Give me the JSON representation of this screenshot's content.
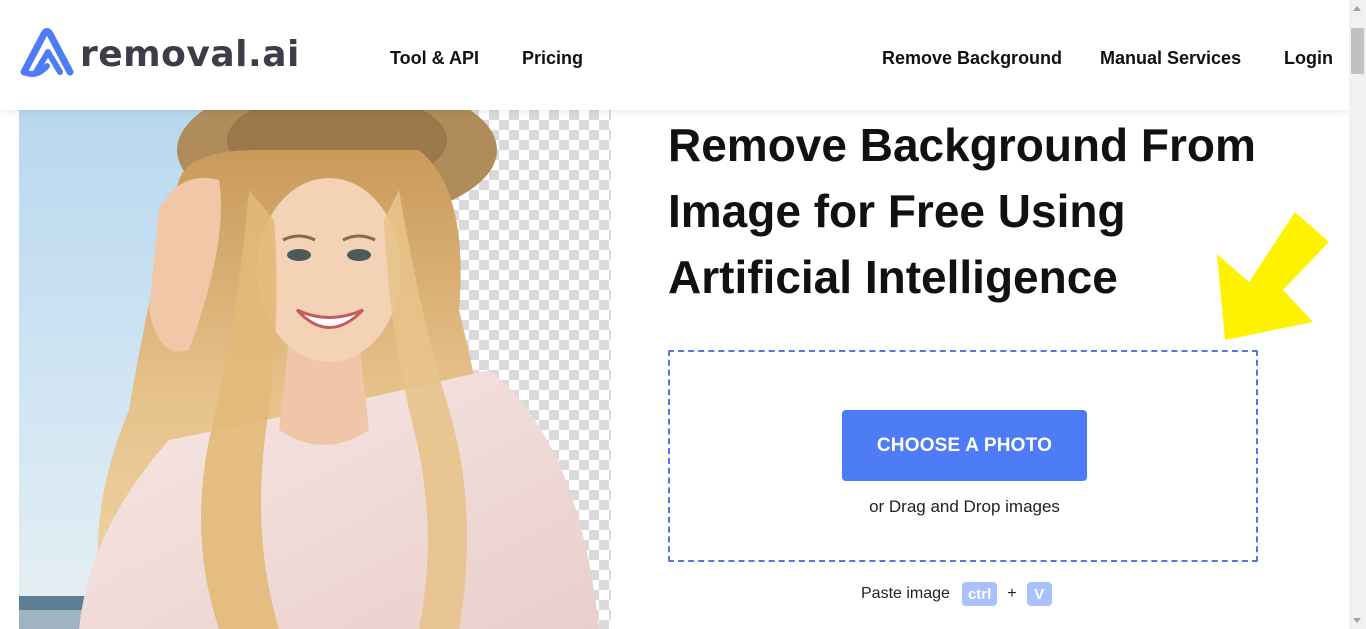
{
  "header": {
    "logo_text": "removal.ai",
    "nav_left": [
      {
        "label": "Tool & API"
      },
      {
        "label": "Pricing"
      }
    ],
    "nav_right": [
      {
        "label": "Remove Background"
      },
      {
        "label": "Manual Services"
      },
      {
        "label": "Login"
      }
    ]
  },
  "hero": {
    "headline_line1": "Remove Background From",
    "headline_line2": "Image for Free Using",
    "headline_line3": "Artificial Intelligence"
  },
  "upload": {
    "button_label": "CHOOSE A PHOTO",
    "drag_text": "or Drag and Drop images",
    "paste_label": "Paste image",
    "key_ctrl": "ctrl",
    "plus": "+",
    "key_v": "V"
  },
  "colors": {
    "accent": "#4e7bf6",
    "dropzone_border": "#4f76e8",
    "arrow": "#fff200",
    "key_bg": "#a9c0fb",
    "logo_blue": "#4e7bf6",
    "logo_text": "#3d3d4a"
  },
  "icons": {
    "logo_mark": "logo-mark-icon",
    "arrow": "arrow-down-left-icon"
  }
}
